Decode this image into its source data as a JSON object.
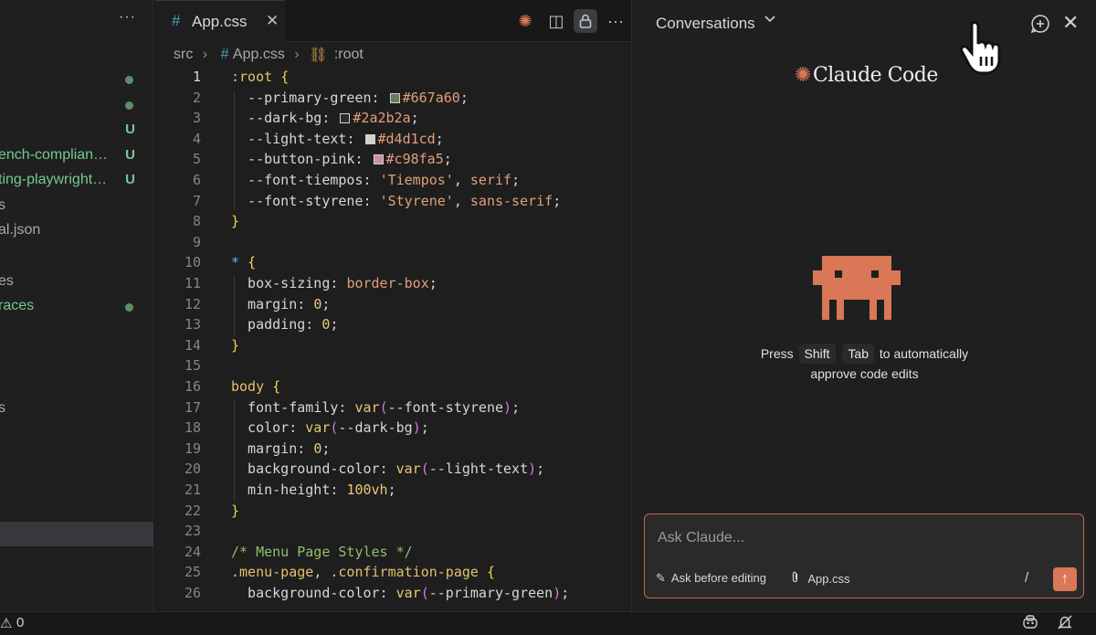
{
  "explorer": {
    "more": "···",
    "items": [
      {
        "name": "",
        "status": "",
        "dot": true,
        "tone": "green"
      },
      {
        "name": "",
        "status": "",
        "dot": true,
        "tone": "green"
      },
      {
        "name": "",
        "status": "U",
        "dot": false,
        "tone": "green"
      },
      {
        "name": "ench-complian…",
        "status": "U",
        "dot": false,
        "tone": "green"
      },
      {
        "name": "ting-playwright…",
        "status": "U",
        "dot": false,
        "tone": "green"
      },
      {
        "name": "s",
        "status": "",
        "dot": false,
        "tone": "muted"
      },
      {
        "name": "al.json",
        "status": "",
        "dot": false,
        "tone": "muted"
      },
      {
        "name": "es",
        "status": "",
        "dot": false,
        "tone": "muted"
      },
      {
        "name": "races",
        "status": "",
        "dot": true,
        "tone": "green"
      },
      {
        "name": "s",
        "status": "",
        "dot": false,
        "tone": "muted"
      }
    ]
  },
  "editor": {
    "tab": {
      "icon": "#",
      "label": "App.css",
      "close": "✕"
    },
    "actions": {
      "claude": "✺",
      "split": "◫",
      "lock": "🔒",
      "more": "···"
    },
    "breadcrumb": {
      "folder": "src",
      "file": "App.css",
      "symbol": ":root"
    },
    "active_line": 1
  },
  "code_lines": [
    [
      [
        "t-sel",
        ":root"
      ],
      [
        "t-punct",
        " "
      ],
      [
        "t-brace",
        "{"
      ]
    ],
    [
      [
        "t-prop",
        "  --primary-green"
      ],
      [
        "t-punct",
        ": "
      ],
      [
        "swatch",
        "#667a60"
      ],
      [
        "t-str",
        "#667a60"
      ],
      [
        "t-punct",
        ";"
      ]
    ],
    [
      [
        "t-prop",
        "  --dark-bg"
      ],
      [
        "t-punct",
        ": "
      ],
      [
        "swatch",
        "#2a2b2a"
      ],
      [
        "t-str",
        "#2a2b2a"
      ],
      [
        "t-punct",
        ";"
      ]
    ],
    [
      [
        "t-prop",
        "  --light-text"
      ],
      [
        "t-punct",
        ": "
      ],
      [
        "swatch",
        "#d4d1cd"
      ],
      [
        "t-str",
        "#d4d1cd"
      ],
      [
        "t-punct",
        ";"
      ]
    ],
    [
      [
        "t-prop",
        "  --button-pink"
      ],
      [
        "t-punct",
        ": "
      ],
      [
        "swatch",
        "#c98fa5"
      ],
      [
        "t-str",
        "#c98fa5"
      ],
      [
        "t-punct",
        ";"
      ]
    ],
    [
      [
        "t-prop",
        "  --font-tiempos"
      ],
      [
        "t-punct",
        ": "
      ],
      [
        "t-str",
        "'Tiempos'"
      ],
      [
        "t-punct",
        ", "
      ],
      [
        "t-str",
        "serif"
      ],
      [
        "t-punct",
        ";"
      ]
    ],
    [
      [
        "t-prop",
        "  --font-styrene"
      ],
      [
        "t-punct",
        ": "
      ],
      [
        "t-str",
        "'Styrene'"
      ],
      [
        "t-punct",
        ", "
      ],
      [
        "t-str",
        "sans-serif"
      ],
      [
        "t-punct",
        ";"
      ]
    ],
    [
      [
        "t-brace",
        "}"
      ]
    ],
    [],
    [
      [
        "t-star",
        "*"
      ],
      [
        "t-punct",
        " "
      ],
      [
        "t-brace",
        "{"
      ]
    ],
    [
      [
        "t-prop",
        "  box-sizing"
      ],
      [
        "t-punct",
        ": "
      ],
      [
        "t-str",
        "border-box"
      ],
      [
        "t-punct",
        ";"
      ]
    ],
    [
      [
        "t-prop",
        "  margin"
      ],
      [
        "t-punct",
        ": "
      ],
      [
        "t-num",
        "0"
      ],
      [
        "t-punct",
        ";"
      ]
    ],
    [
      [
        "t-prop",
        "  padding"
      ],
      [
        "t-punct",
        ": "
      ],
      [
        "t-num",
        "0"
      ],
      [
        "t-punct",
        ";"
      ]
    ],
    [
      [
        "t-brace",
        "}"
      ]
    ],
    [],
    [
      [
        "t-sel",
        "body"
      ],
      [
        "t-punct",
        " "
      ],
      [
        "t-brace",
        "{"
      ]
    ],
    [
      [
        "t-prop",
        "  font-family"
      ],
      [
        "t-punct",
        ": "
      ],
      [
        "t-fn",
        "var"
      ],
      [
        "t-paren",
        "("
      ],
      [
        "t-var",
        "--font-styrene"
      ],
      [
        "t-paren",
        ")"
      ],
      [
        "t-punct",
        ";"
      ]
    ],
    [
      [
        "t-prop",
        "  color"
      ],
      [
        "t-punct",
        ": "
      ],
      [
        "t-fn",
        "var"
      ],
      [
        "t-paren",
        "("
      ],
      [
        "t-var",
        "--dark-bg"
      ],
      [
        "t-paren",
        ")"
      ],
      [
        "t-punct",
        ";"
      ]
    ],
    [
      [
        "t-prop",
        "  margin"
      ],
      [
        "t-punct",
        ": "
      ],
      [
        "t-num",
        "0"
      ],
      [
        "t-punct",
        ";"
      ]
    ],
    [
      [
        "t-prop",
        "  background-color"
      ],
      [
        "t-punct",
        ": "
      ],
      [
        "t-fn",
        "var"
      ],
      [
        "t-paren",
        "("
      ],
      [
        "t-var",
        "--light-text"
      ],
      [
        "t-paren",
        ")"
      ],
      [
        "t-punct",
        ";"
      ]
    ],
    [
      [
        "t-prop",
        "  min-height"
      ],
      [
        "t-punct",
        ": "
      ],
      [
        "t-num",
        "100vh"
      ],
      [
        "t-punct",
        ";"
      ]
    ],
    [
      [
        "t-brace",
        "}"
      ]
    ],
    [],
    [
      [
        "t-cmt",
        "/* Menu Page Styles */"
      ]
    ],
    [
      [
        "t-sel",
        ".menu-page"
      ],
      [
        "t-punct",
        ", "
      ],
      [
        "t-sel",
        ".confirmation-page"
      ],
      [
        "t-punct",
        " "
      ],
      [
        "t-brace",
        "{"
      ]
    ],
    [
      [
        "t-prop",
        "  background-color"
      ],
      [
        "t-punct",
        ": "
      ],
      [
        "t-fn",
        "var"
      ],
      [
        "t-paren",
        "("
      ],
      [
        "t-var",
        "--primary-green"
      ],
      [
        "t-paren",
        ")"
      ],
      [
        "t-punct",
        ";"
      ]
    ]
  ],
  "claude_panel": {
    "title": "Conversations",
    "chevron": "⌄",
    "close": "✕",
    "brand_star": "✺",
    "brand": "Claude Code",
    "hint_press": "Press",
    "hint_key1": "Shift",
    "hint_key2": "Tab",
    "hint_rest1": "to automatically",
    "hint_rest2": "approve code edits",
    "input_placeholder": "Ask Claude...",
    "mode_icon": "✎",
    "mode_label": "Ask before editing",
    "file_icon": "📎",
    "file_label": "App.css",
    "slash": "/",
    "send_icon": "↑",
    "accent": "#d97757"
  },
  "statusbar": {
    "warn_icon": "⚠",
    "warn_count": "0",
    "copilot_icon": "☻",
    "bell_icon": "🔕"
  }
}
